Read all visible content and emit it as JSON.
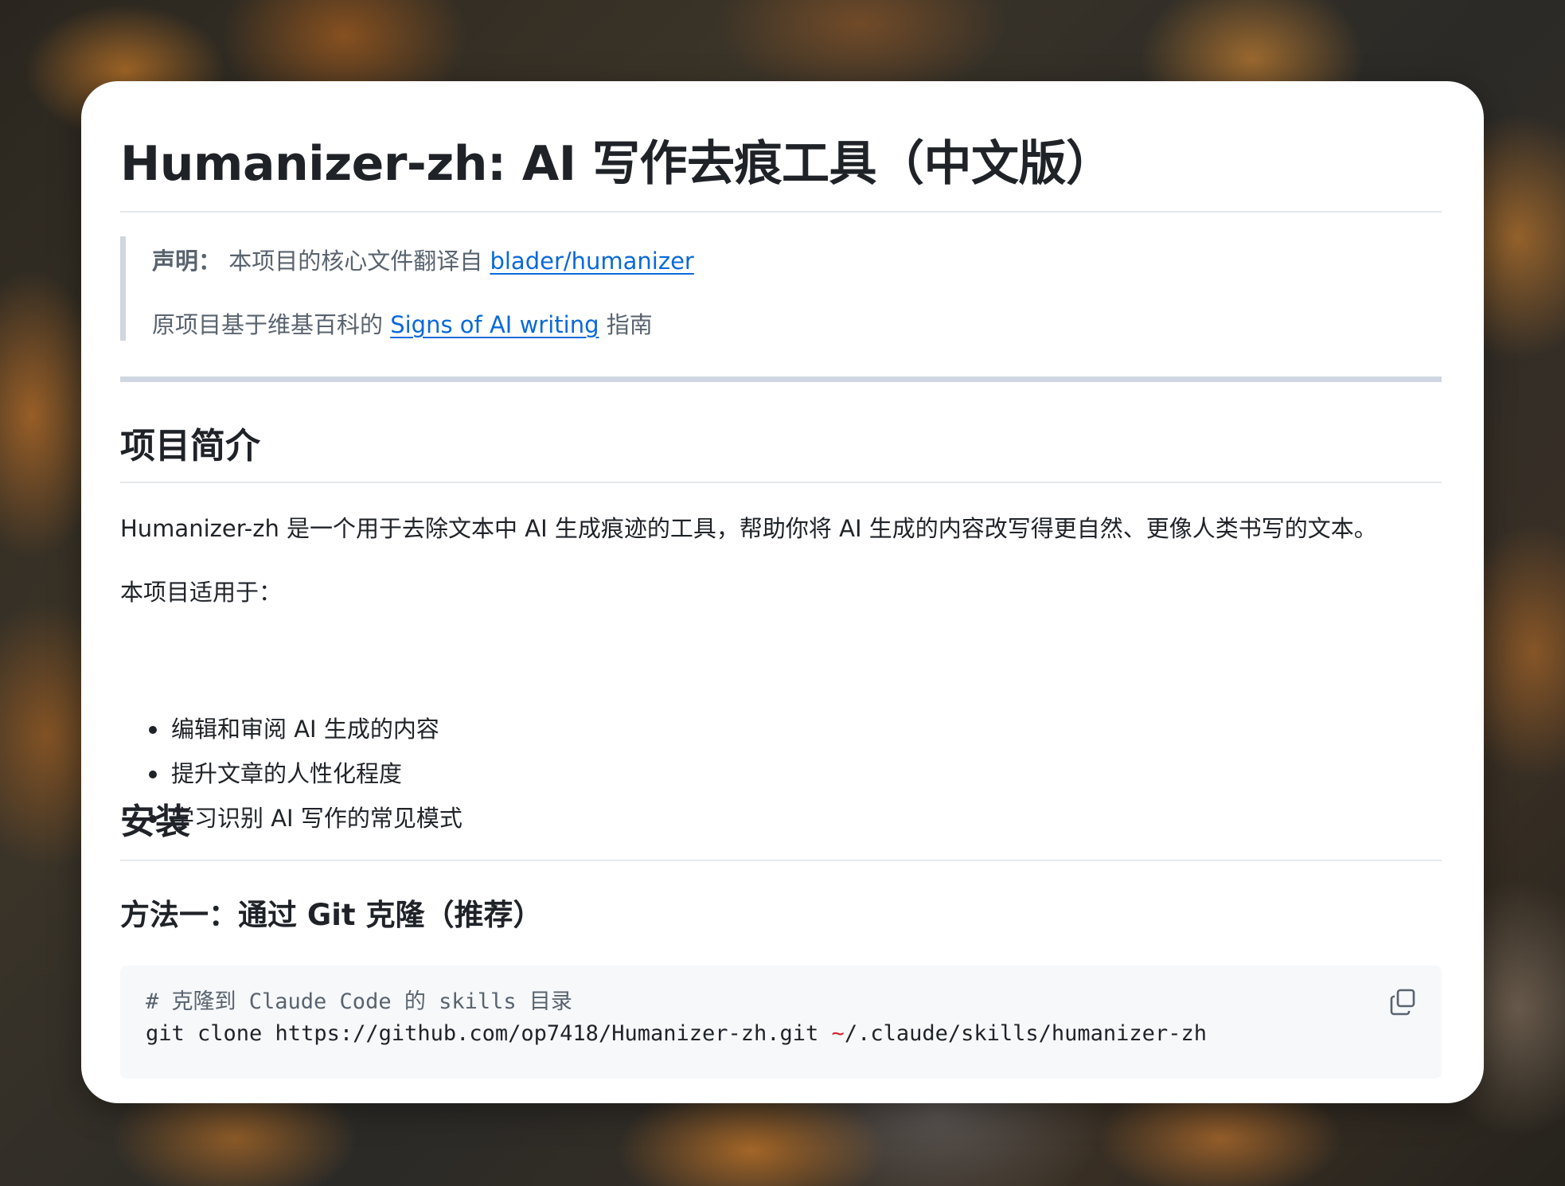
{
  "title": "Humanizer-zh: AI 写作去痕工具（中文版）",
  "notice": {
    "label": "声明：",
    "text": " 本项目的核心文件翻译自 ",
    "link1": "blader/humanizer",
    "line2_prefix": "原项目基于维基百科的 ",
    "link2": "Signs of AI writing",
    "line2_suffix": " 指南"
  },
  "intro": {
    "heading": "项目简介",
    "description": "Humanizer-zh 是一个用于去除文本中 AI 生成痕迹的工具，帮助你将 AI 生成的内容改写得更自然、更像人类书写的文本。",
    "applies_to": "本项目适用于：",
    "items": [
      "编辑和审阅 AI 生成的内容",
      "提升文章的人性化程度",
      "学习识别 AI 写作的常见模式"
    ]
  },
  "install": {
    "heading": "安装",
    "method1": "方法一：通过 Git 克隆（推荐）",
    "code_comment": "# 克隆到 Claude Code 的 skills 目录",
    "code_cmd_prefix": "git clone https://github.com/op7418/Humanizer-zh.git ",
    "code_tilde": "~",
    "code_cmd_suffix": "/.claude/skills/humanizer-zh",
    "copy_icon": "copy-icon"
  },
  "colors": {
    "text": "#1f2328",
    "muted": "#59636e",
    "link": "#0969da",
    "code_bg": "#f6f8fa",
    "tilde": "#cf222e"
  }
}
